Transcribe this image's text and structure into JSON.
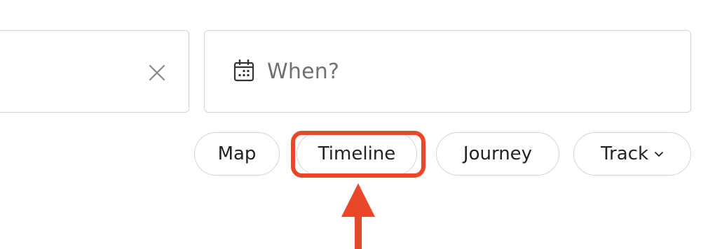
{
  "search": {
    "when_placeholder": "When?"
  },
  "view_tabs": [
    {
      "label": "Map"
    },
    {
      "label": "Timeline"
    },
    {
      "label": "Journey"
    },
    {
      "label": "Track"
    }
  ],
  "icons": {
    "clear": "close-icon",
    "calendar": "calendar-icon",
    "dropdown": "chevron-down-icon"
  },
  "colors": {
    "highlight": "#e8472a",
    "border": "#d4d4d4",
    "placeholder": "#707070",
    "text": "#222222"
  }
}
